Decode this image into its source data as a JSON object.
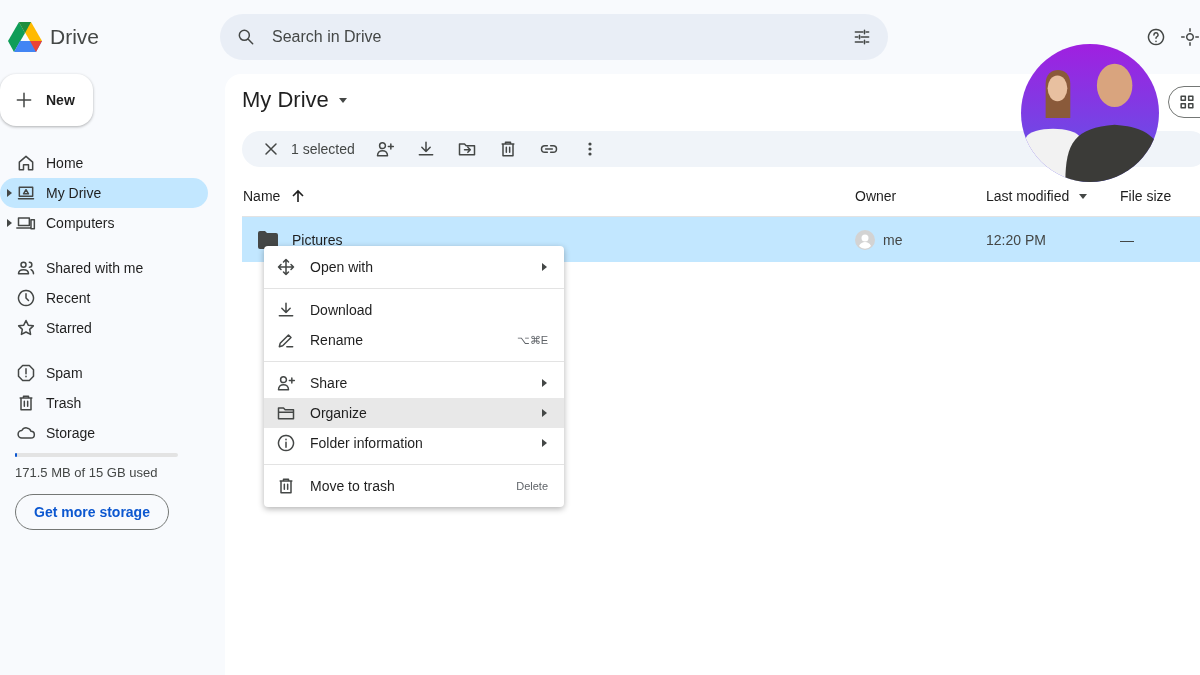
{
  "app": {
    "name": "Drive"
  },
  "search": {
    "placeholder": "Search in Drive"
  },
  "new_button": {
    "label": "New"
  },
  "sidebar": {
    "groups": [
      [
        {
          "label": "Home",
          "selected": false,
          "expandable": false
        },
        {
          "label": "My Drive",
          "selected": true,
          "expandable": true
        },
        {
          "label": "Computers",
          "selected": false,
          "expandable": true
        }
      ],
      [
        {
          "label": "Shared with me",
          "selected": false,
          "expandable": false
        },
        {
          "label": "Recent",
          "selected": false,
          "expandable": false
        },
        {
          "label": "Starred",
          "selected": false,
          "expandable": false
        }
      ],
      [
        {
          "label": "Spam",
          "selected": false,
          "expandable": false
        },
        {
          "label": "Trash",
          "selected": false,
          "expandable": false
        },
        {
          "label": "Storage",
          "selected": false,
          "expandable": false
        }
      ]
    ]
  },
  "storage": {
    "level": 0.01,
    "text": "171.5 MB of 15 GB used",
    "button": "Get more storage"
  },
  "title": "My Drive",
  "selection_bar": {
    "count": "1 selected"
  },
  "table": {
    "columns": [
      {
        "label": "Name",
        "kind": "sorted"
      },
      {
        "label": "Owner",
        "kind": "plain"
      },
      {
        "label": "Last modified",
        "kind": "dropdown"
      },
      {
        "label": "File size",
        "kind": "plain"
      }
    ],
    "rows": [
      {
        "name": "Pictures",
        "owner": "me",
        "modified": "12:20 PM",
        "size": "—",
        "selected": true
      }
    ]
  },
  "context_menu": {
    "groups": [
      [
        {
          "label": "Open with",
          "submenu": true,
          "highlighted": false
        }
      ],
      [
        {
          "label": "Download",
          "submenu": false,
          "highlighted": false
        },
        {
          "label": "Rename",
          "shortcut": "⌥⌘E",
          "submenu": false,
          "highlighted": false
        }
      ],
      [
        {
          "label": "Share",
          "submenu": true,
          "highlighted": false
        },
        {
          "label": "Organize",
          "submenu": true,
          "highlighted": true
        },
        {
          "label": "Folder information",
          "submenu": true,
          "highlighted": false
        }
      ],
      [
        {
          "label": "Move to trash",
          "shortcut": "Delete",
          "submenu": false,
          "highlighted": false
        }
      ]
    ]
  }
}
